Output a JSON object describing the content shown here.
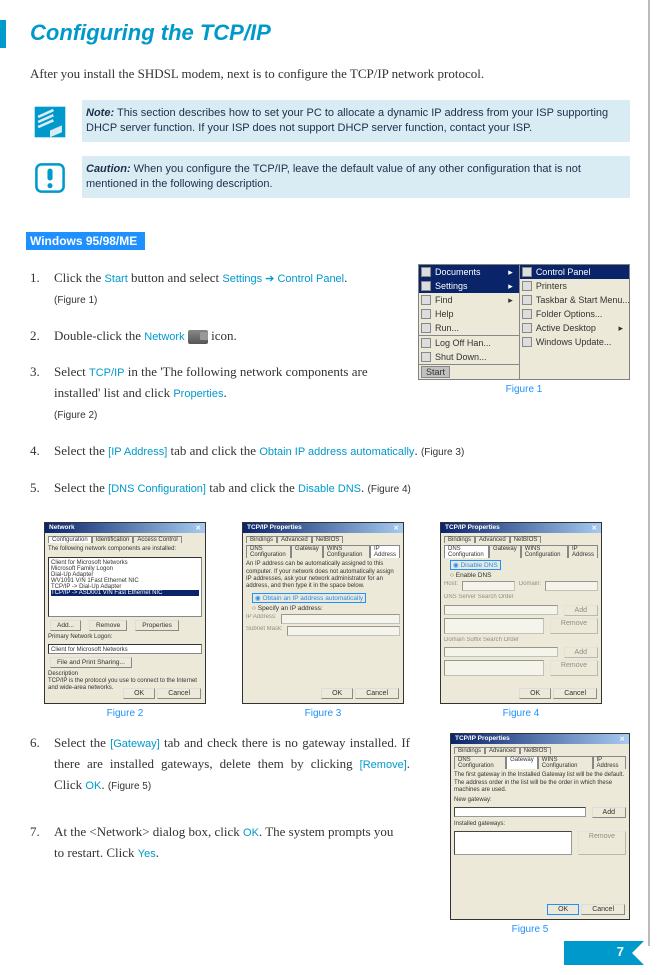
{
  "title": "Configuring the TCP/IP",
  "intro": "After you install the SHDSL modem, next is to configure the TCP/IP network protocol.",
  "note_label": "Note:",
  "note_text": "This section describes how to set your PC to allocate a dynamic IP address from your ISP supporting DHCP server function. If your ISP does not support DHCP server function, contact your ISP.",
  "caution_label": "Caution:",
  "caution_text": "When you configure the TCP/IP, leave the default value of any other configuration that is not mentioned in the following description.",
  "section_label": "Windows 95/98/ME",
  "steps": {
    "s1a": "Click the ",
    "s1_start": "Start",
    "s1b": " button and select ",
    "s1_settings": "Settings",
    "s1_arrow": " ➔ ",
    "s1_cpanel": "Control Panel",
    "s1c": ".",
    "s1_fig": "(Figure 1)",
    "s2a": "Double-click the ",
    "s2_network": "Network",
    "s2b": " icon.",
    "s3a": "Select ",
    "s3_tcpip": "TCP/IP",
    "s3b": " in the 'The following network components are installed' list and click ",
    "s3_props": "Properties",
    "s3c": ".",
    "s3_fig": "(Figure 2)",
    "s4a": "Select the ",
    "s4_tab": "[IP Address]",
    "s4b": " tab and click the ",
    "s4_opt": "Obtain IP address automatically",
    "s4c": ". ",
    "s4_fig": "(Figure 3)",
    "s5a": "Select the ",
    "s5_tab": "[DNS Configuration]",
    "s5b": " tab and click the ",
    "s5_opt": "Disable DNS",
    "s5c": ". ",
    "s5_fig": "(Figure 4)",
    "s6a": "Select the ",
    "s6_tab": "[Gateway]",
    "s6b": " tab and check there is no gateway installed. If there are installed gateways, delete them by clicking ",
    "s6_remove": "[Remove]",
    "s6c": ". Click ",
    "s6_ok": "OK",
    "s6d": ". ",
    "s6_fig": "(Figure 5)",
    "s7a": "At the <Network> dialog box, click ",
    "s7_ok": "OK",
    "s7b": ". The system prompts you to restart. Click ",
    "s7_yes": "Yes",
    "s7c": "."
  },
  "fig": {
    "f1": "Figure 1",
    "f2": "Figure 2",
    "f3": "Figure 3",
    "f4": "Figure 4",
    "f5": "Figure 5"
  },
  "startmenu": {
    "left": {
      "docs": "Documents",
      "settings": "Settings",
      "find": "Find",
      "help": "Help",
      "run": "Run...",
      "logoff": "Log Off Han...",
      "shutdown": "Shut Down...",
      "start": "Start"
    },
    "right": {
      "cpanel": "Control Panel",
      "printers": "Printers",
      "taskbar": "Taskbar & Start Menu...",
      "folder": "Folder Options...",
      "active": "Active Desktop",
      "winup": "Windows Update..."
    }
  },
  "dialog_network": {
    "title": "Network",
    "tabs": {
      "a": "Configuration",
      "b": "Identification",
      "c": "Access Control"
    },
    "instr": "The following network components are installed:",
    "items": {
      "a": "Client for Microsoft Networks",
      "b": "Microsoft Family Logon",
      "c": "Dial-Up Adapter",
      "d": "WV1091 V/N 1Fast Ethernet NIC",
      "e": "TCP/IP -> Dial-Up Adapter",
      "f": "TCP/IP -> ASD001 V/N Fast Ethernet NIC"
    },
    "btns": {
      "add": "Add...",
      "remove": "Remove",
      "props": "Properties"
    },
    "plogon": "Primary Network Logon:",
    "plogon_val": "Client for Microsoft Networks",
    "fps": "File and Print Sharing...",
    "desc_h": "Description",
    "desc_t": "TCP/IP is the protocol you use to connect to the Internet and wide-area networks.",
    "ok": "OK",
    "cancel": "Cancel"
  },
  "dialog_ip": {
    "title": "TCP/IP Properties",
    "tabs": {
      "a": "Bindings",
      "b": "Advanced",
      "c": "NetBIOS",
      "d": "DNS Configuration",
      "e": "Gateway",
      "f": "WINS Configuration",
      "g": "IP Address"
    },
    "desc": "An IP address can be automatically assigned to this computer. If your network does not automatically assign IP addresses, ask your network administrator for an address, and then type it in the space below.",
    "r1": "Obtain an IP address automatically",
    "r2": "Specify an IP address:",
    "ipl": "IP Address:",
    "snl": "Subnet Mask:",
    "ok": "OK",
    "cancel": "Cancel"
  },
  "dialog_dns": {
    "title": "TCP/IP Properties",
    "r1": "Disable DNS",
    "r2": "Enable DNS",
    "host": "Host:",
    "domain": "Domain:",
    "searchorder": "DNS Server Search Order",
    "suffixorder": "Domain Suffix Search Order",
    "add": "Add",
    "remove": "Remove",
    "ok": "OK",
    "cancel": "Cancel"
  },
  "dialog_gw": {
    "title": "TCP/IP Properties",
    "desc": "The first gateway in the Installed Gateway list will be the default. The address order in the list will be the order in which these machines are used.",
    "newgw": "New gateway:",
    "add": "Add",
    "installed": "Installed gateways:",
    "remove": "Remove",
    "ok": "OK",
    "cancel": "Cancel"
  },
  "page_num": "7"
}
